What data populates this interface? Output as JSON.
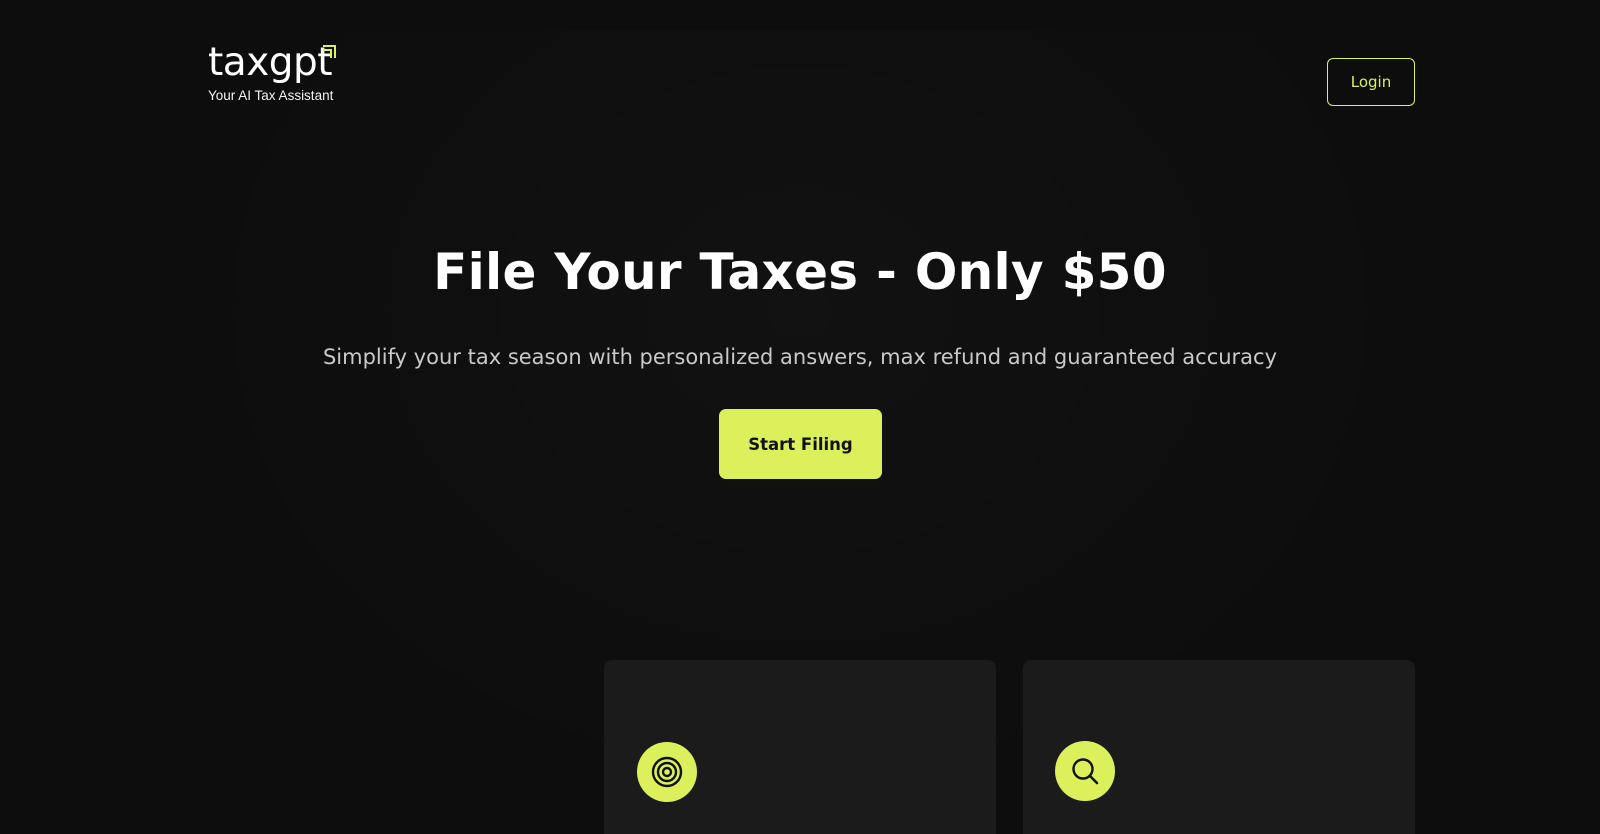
{
  "header": {
    "logo_text": "taxgpt",
    "tagline": "Your AI Tax Assistant",
    "login_label": "Login"
  },
  "hero": {
    "title": "File Your Taxes - Only $50",
    "subtitle": "Simplify your tax season with personalized answers, max refund and guaranteed accuracy",
    "cta_label": "Start Filing"
  },
  "features": [
    {
      "icon": "target-icon",
      "title": ""
    },
    {
      "icon": "search-icon",
      "title": ""
    }
  ],
  "colors": {
    "background": "#0d0d0d",
    "accent": "#dcf05c",
    "card": "#1b1b1b",
    "text": "#ffffff",
    "muted_text": "#c9c9c9"
  }
}
